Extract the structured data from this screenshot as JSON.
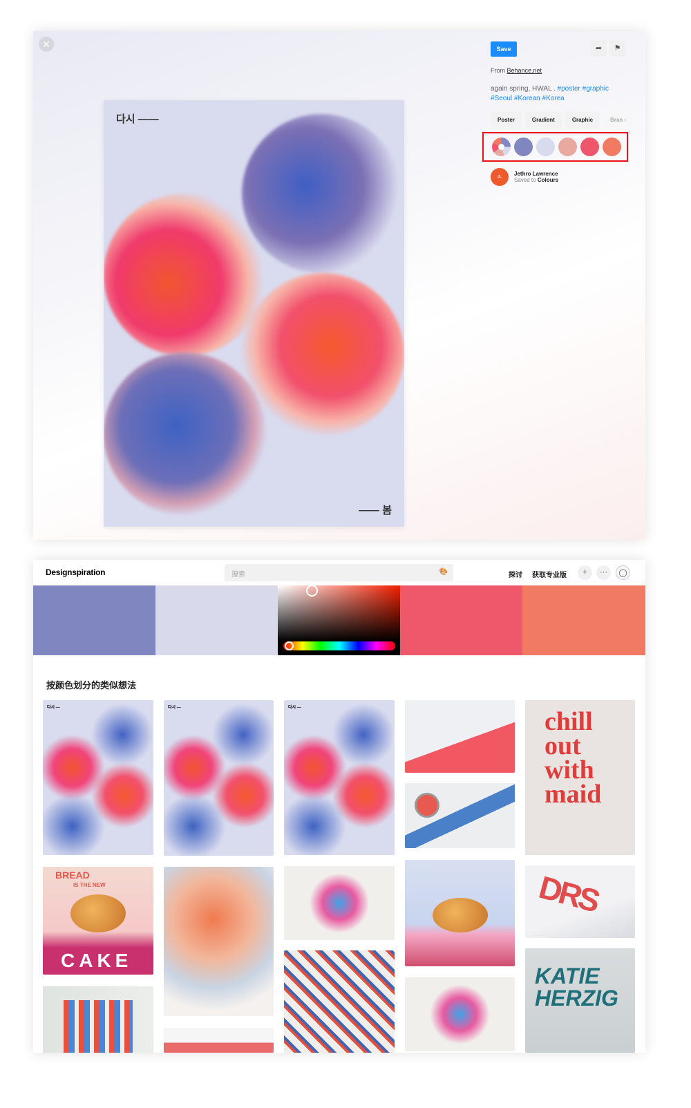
{
  "pin": {
    "close_icon": "close-icon",
    "poster": {
      "top_text": "다시 ——",
      "bottom_text": "—— 봄"
    },
    "save_label": "Save",
    "share_icon": "share-arrow-icon",
    "flag_icon": "flag-icon",
    "from_label": "From",
    "from_link": "Behance.net",
    "description": "again spring, HWAL .",
    "tags_line1": "#poster #graphic",
    "tags_line2": "#Seoul #Korean #Korea",
    "chips": [
      "Poster",
      "Gradient",
      "Graphic",
      "Bran"
    ],
    "palette": [
      "#7f86c0",
      "#d8daee",
      "#e8a9a1",
      "#ef566b",
      "#f07a62"
    ],
    "user": {
      "avatar_text": "JETHRO LAWRENCE",
      "name": "Jethro Lawrence",
      "saved_prefix": "Saved to",
      "board": "Colours"
    }
  },
  "site": {
    "logo": "Designspiration",
    "search_placeholder": "搜索",
    "palette_icon": "palette-icon",
    "nav": [
      "探讨",
      "获取专业版"
    ],
    "add_icon": "plus-icon",
    "more_icon": "more-icon",
    "avatar_icon": "user-avatar-icon",
    "color_strips": [
      "#7f86c0",
      "#d8daec",
      "picker",
      "#ef586b",
      "#f07a62"
    ],
    "section_title": "按颜色划分的类似想法",
    "tiles": {
      "chill": "chill out with maid",
      "bread_top": "BREAD",
      "bread_mid": "IS THE NEW",
      "bread_cake": "CAKE",
      "katie": "KATIE HERZIG",
      "poster_label": "다시 —"
    }
  }
}
